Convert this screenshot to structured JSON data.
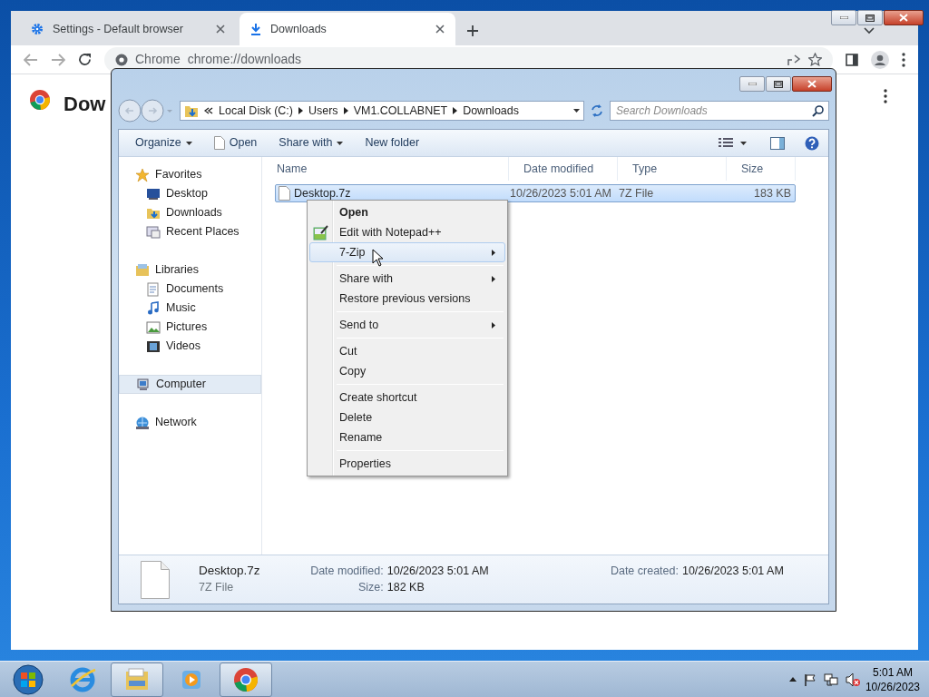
{
  "chrome": {
    "tabs": [
      {
        "label": "Settings - Default browser",
        "selected": false
      },
      {
        "label": "Downloads",
        "selected": true
      }
    ],
    "omnibox": {
      "chip": "Chrome",
      "url": "chrome://downloads"
    },
    "page_title": "Dow"
  },
  "explorer": {
    "breadcrumb": [
      "Local Disk (C:)",
      "Users",
      "VM1.COLLABNET",
      "Downloads"
    ],
    "search": {
      "placeholder": "Search Downloads"
    },
    "commands": [
      {
        "label": "Organize",
        "dropdown": true
      },
      {
        "label": "Open",
        "dropdown": false
      },
      {
        "label": "Share with",
        "dropdown": true
      },
      {
        "label": "New folder",
        "dropdown": false
      }
    ],
    "nav": [
      {
        "label": "Favorites",
        "selected": false,
        "children": [
          {
            "label": "Desktop",
            "selected": false
          },
          {
            "label": "Downloads",
            "selected": false
          },
          {
            "label": "Recent Places",
            "selected": false
          }
        ]
      },
      {
        "label": "Libraries",
        "selected": false,
        "children": [
          {
            "label": "Documents",
            "selected": false
          },
          {
            "label": "Music",
            "selected": false
          },
          {
            "label": "Pictures",
            "selected": false
          },
          {
            "label": "Videos",
            "selected": false
          }
        ]
      },
      {
        "label": "Computer",
        "selected": true
      },
      {
        "label": "Network",
        "selected": false
      }
    ],
    "columns": [
      "Name",
      "Date modified",
      "Type",
      "Size"
    ],
    "files": [
      {
        "name": "Desktop.7z",
        "date_modified": "10/26/2023 5:01 AM",
        "type": "7Z File",
        "size": "183 KB",
        "selected": true
      }
    ],
    "details": {
      "name": "Desktop.7z",
      "type": "7Z File",
      "fields": [
        {
          "label": "Date modified:",
          "value": "10/26/2023 5:01 AM"
        },
        {
          "label": "Size:",
          "value": "182 KB"
        },
        {
          "label": "Date created:",
          "value": "10/26/2023 5:01 AM"
        }
      ]
    }
  },
  "context_menu": {
    "groups": [
      [
        {
          "label": "Open",
          "default": true,
          "submenu": false,
          "selected": false
        },
        {
          "label": "Edit with Notepad++",
          "default": false,
          "submenu": false,
          "selected": false
        },
        {
          "label": "7-Zip",
          "default": false,
          "submenu": true,
          "selected": true
        }
      ],
      [
        {
          "label": "Share with",
          "default": false,
          "submenu": true,
          "selected": false
        },
        {
          "label": "Restore previous versions",
          "default": false,
          "submenu": false,
          "selected": false
        }
      ],
      [
        {
          "label": "Send to",
          "default": false,
          "submenu": true,
          "selected": false
        }
      ],
      [
        {
          "label": "Cut",
          "default": false,
          "submenu": false,
          "selected": false
        },
        {
          "label": "Copy",
          "default": false,
          "submenu": false,
          "selected": false
        }
      ],
      [
        {
          "label": "Create shortcut",
          "default": false,
          "submenu": false,
          "selected": false
        },
        {
          "label": "Delete",
          "default": false,
          "submenu": false,
          "selected": false
        },
        {
          "label": "Rename",
          "default": false,
          "submenu": false,
          "selected": false
        }
      ],
      [
        {
          "label": "Properties",
          "default": false,
          "submenu": false,
          "selected": false
        }
      ]
    ]
  },
  "taskbar": {
    "apps": [
      {
        "active": false
      },
      {
        "active": true
      },
      {
        "active": false
      },
      {
        "active": true
      }
    ],
    "clock": {
      "time": "5:01 AM",
      "date": "10/26/2023"
    }
  }
}
